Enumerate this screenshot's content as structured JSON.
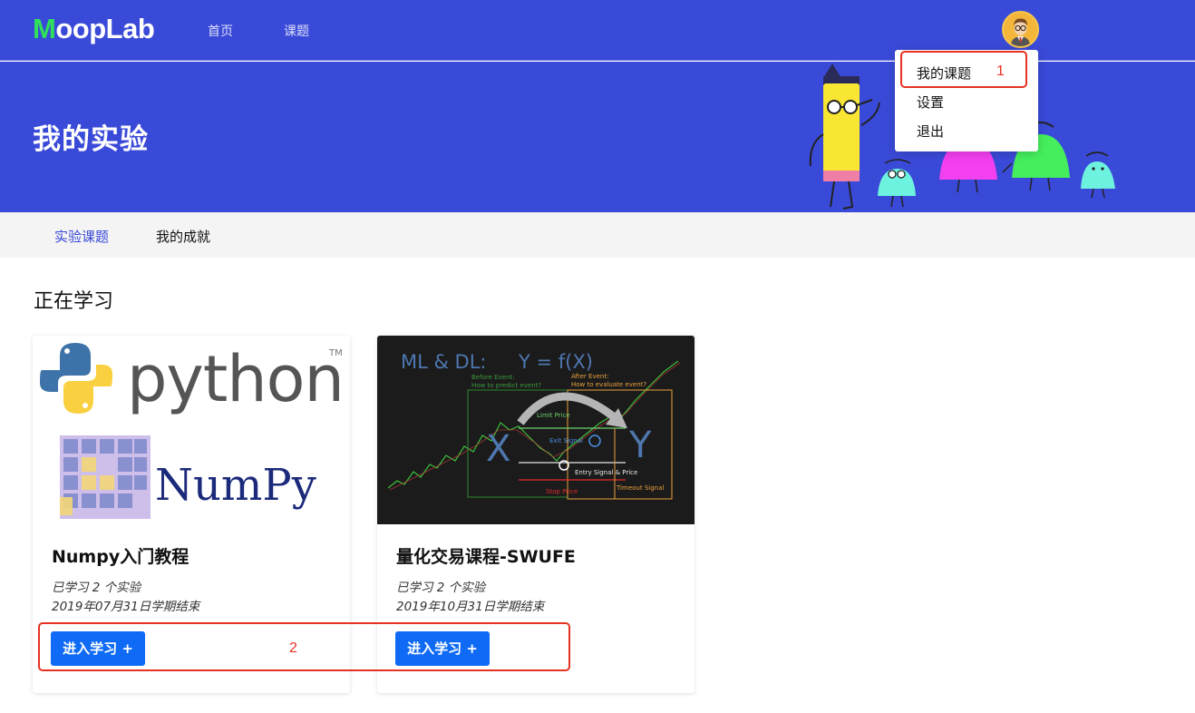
{
  "nav": {
    "logo_first": "M",
    "logo_rest": "oopLab",
    "links": [
      "首页",
      "课题"
    ]
  },
  "hero": {
    "title": "我的实验"
  },
  "dropdown": {
    "items": [
      "我的课题",
      "设置",
      "退出"
    ]
  },
  "tabs": {
    "items": [
      "实验课题",
      "我的成就"
    ],
    "active": 0
  },
  "section": {
    "title": "正在学习"
  },
  "cards": [
    {
      "title": "Numpy入门教程",
      "learned": "已学习 2 个实验",
      "term_end": "2019年07月31日学期结束",
      "button": "进入学习 +",
      "image": {
        "python_word": "python",
        "tm": "TM",
        "numpy_word": "NumPy"
      }
    },
    {
      "title": "量化交易课程-SWUFE",
      "learned": "已学习 2 个实验",
      "term_end": "2019年10月31日学期结束",
      "button": "进入学习 +",
      "image": {
        "heading": "ML & DL:",
        "formula": "Y = f(X)",
        "before_event": "Before Event:",
        "before_q": "How to predict event?",
        "after_event": "After Event:",
        "after_q": "How to evaluate event?",
        "limit_price": "Limit Price",
        "exit_signal": "Exit Signal",
        "entry_signal": "Entry Signal & Price",
        "timeout_signal": "Timeout Signal",
        "stop_price": "Stop Price",
        "x_label": "X",
        "y_label": "Y"
      }
    }
  ],
  "annotations": {
    "marker1": "1",
    "marker2": "2"
  },
  "colors": {
    "brand": "#3a4ad8",
    "button": "#0f6bf5",
    "marker": "#e53222",
    "logo_accent": "#2fe05a"
  }
}
